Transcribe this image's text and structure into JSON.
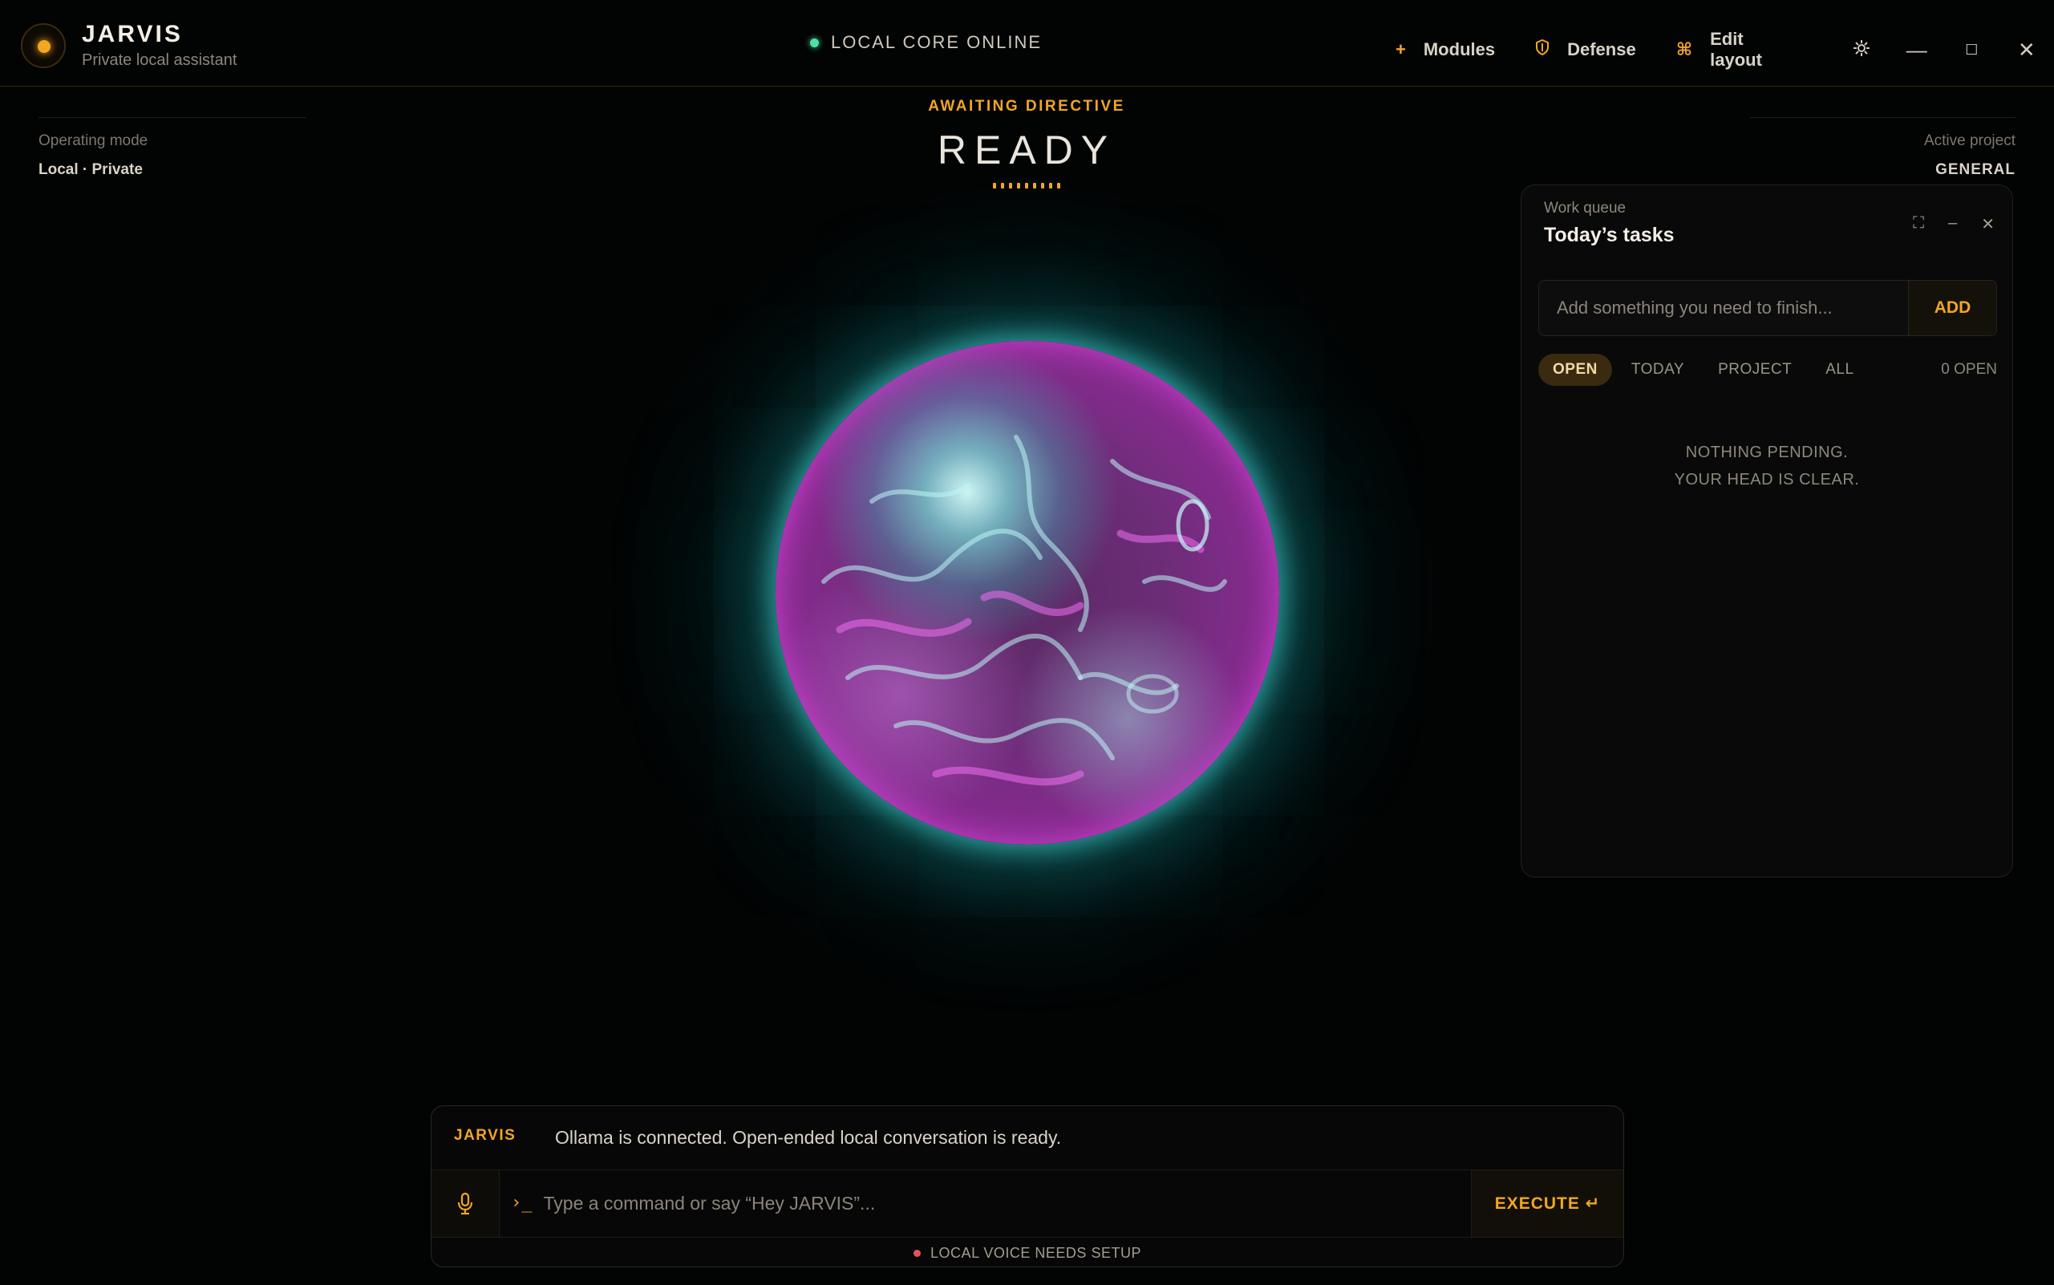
{
  "app": {
    "title": "JARVIS",
    "subtitle": "Private local assistant",
    "accent_color": "#f2a623"
  },
  "status": {
    "core_text": "LOCAL CORE ONLINE",
    "core_color": "#4fe0a3"
  },
  "toolbar": {
    "modules_label": "Modules",
    "modules_icon": "plus-icon",
    "defense_label": "Defense",
    "defense_icon": "shield-icon",
    "edit_layout_label": "Edit layout",
    "edit_layout_icon": "command-icon",
    "settings_icon": "gear-icon",
    "minimize_icon": "minimize-icon",
    "maximize_icon": "maximize-icon",
    "close_icon": "close-icon"
  },
  "meta": {
    "operating_mode_label": "Operating mode",
    "operating_mode_value": "Local · Private",
    "active_project_label": "Active project",
    "active_project_value": "GENERAL"
  },
  "center": {
    "awaiting": "AWAITING DIRECTIVE",
    "state": "READY"
  },
  "tasks": {
    "kicker": "Work queue",
    "title": "Today’s tasks",
    "input_placeholder": "Add something you need to finish...",
    "add_label": "ADD",
    "filters": [
      "OPEN",
      "TODAY",
      "PROJECT",
      "ALL"
    ],
    "active_filter": "OPEN",
    "open_count": "0 OPEN",
    "empty_line1": "NOTHING PENDING.",
    "empty_line2": "YOUR HEAD IS CLEAR."
  },
  "console": {
    "speaker": "JARVIS",
    "message": "Ollama is connected. Open-ended local conversation is ready.",
    "prompt_glyph": "›_",
    "command_placeholder": "Type a command or say “Hey JARVIS”...",
    "execute_label": "EXECUTE ↵",
    "voice_status": "LOCAL VOICE NEEDS SETUP",
    "voice_status_color": "#e25555"
  }
}
